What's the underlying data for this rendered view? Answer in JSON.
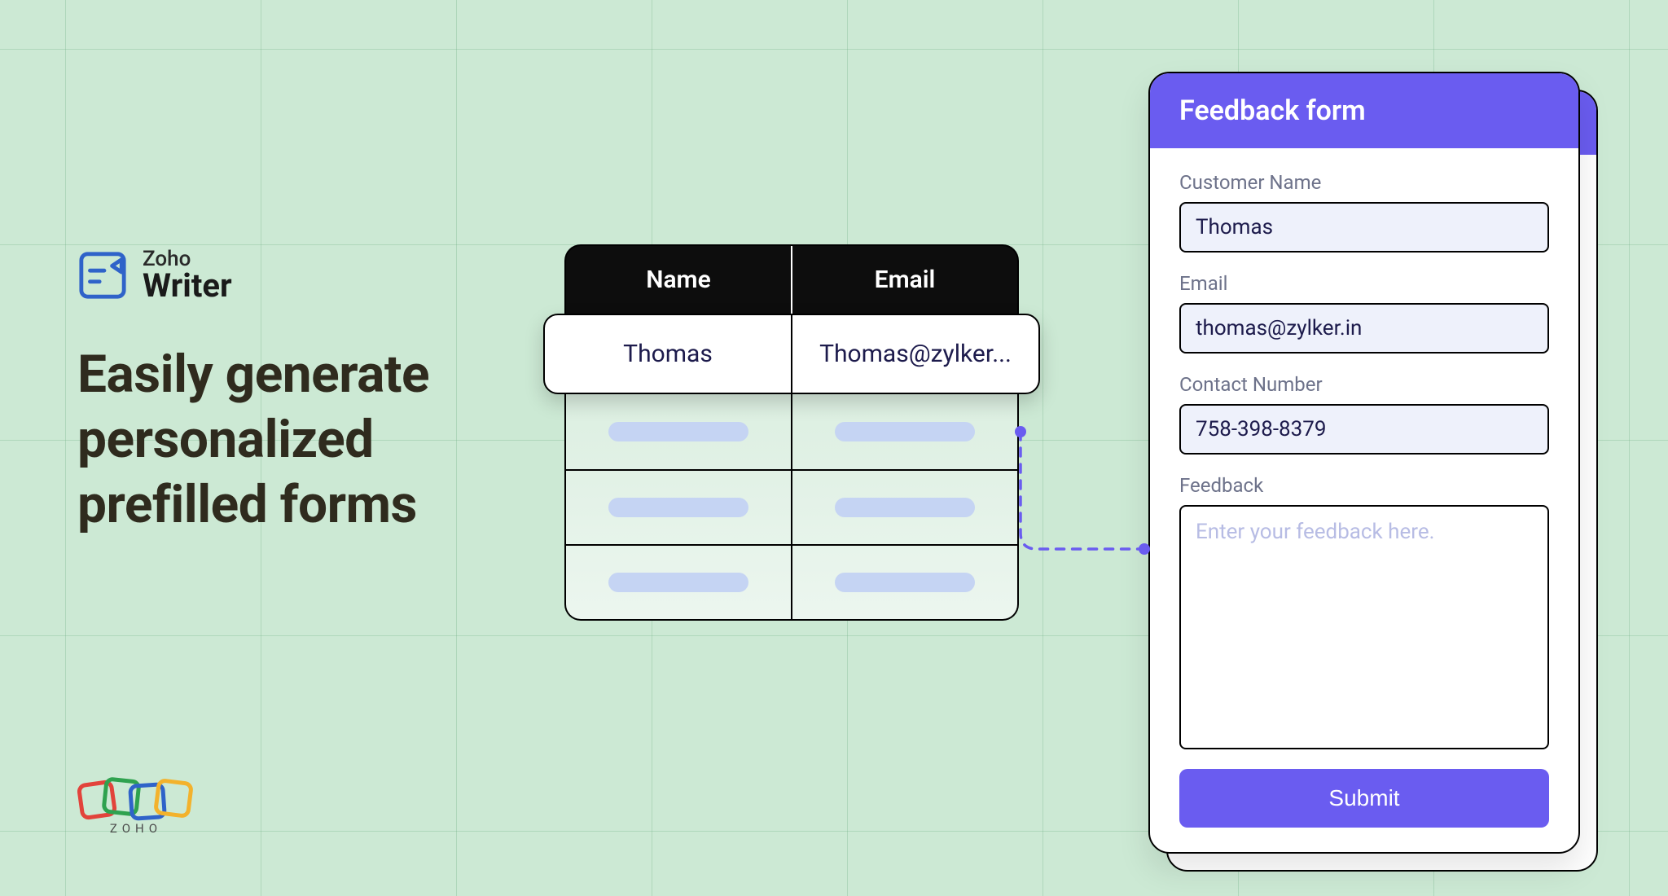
{
  "brand": {
    "over": "Zoho",
    "name": "Writer"
  },
  "headline_lines": [
    "Easily generate",
    "personalized",
    "prefilled forms"
  ],
  "table": {
    "headers": [
      "Name",
      "Email"
    ],
    "hero_row": {
      "name": "Thomas",
      "email": "Thomas@zylker..."
    }
  },
  "form": {
    "title": "Feedback form",
    "fields": {
      "customer_name": {
        "label": "Customer Name",
        "value": "Thomas"
      },
      "email": {
        "label": "Email",
        "value": "thomas@zylker.in"
      },
      "contact": {
        "label": "Contact Number",
        "value": "758-398-8379"
      },
      "feedback": {
        "label": "Feedback",
        "placeholder": "Enter your feedback here."
      }
    },
    "submit_label": "Submit"
  },
  "footer_brand": "ZOHO",
  "colors": {
    "accent": "#6a5cf0",
    "bg": "#cce9d4"
  }
}
